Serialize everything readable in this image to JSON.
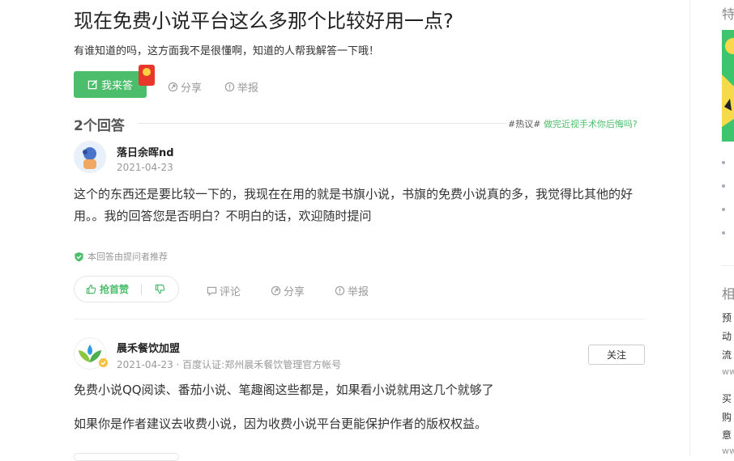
{
  "question": {
    "title": "现在免费小说平台这么多那个比较好用一点?",
    "description": "有谁知道的吗，这方面我不是很懂啊，知道的人帮我解答一下哦！"
  },
  "actions": {
    "answer_label": "我来答",
    "share_label": "分享",
    "report_label": "举报"
  },
  "answers_header": {
    "count_label": "2个回答",
    "hot_tag": "#热议#",
    "hot_link": "做完近视手术你后悔吗?"
  },
  "answers": [
    {
      "user": "落日余晖nd",
      "date": "2021-04-23",
      "paragraphs": [
        "这个的东西还是要比较一下的，我现在在用的就是书旗小说，书旗的免费小说真的多，我觉得比其他的好用。。我的回答您是否明白？不明白的话，欢迎随时提问"
      ],
      "recommend_label": "本回答由提问者推荐",
      "upvote_label": "抢首赞",
      "comment_label": "评论",
      "share_label": "分享",
      "report_label": "举报"
    },
    {
      "user": "晨禾餐饮加盟",
      "meta": "2021-04-23 · 百度认证:郑州晨禾餐饮管理官方帐号",
      "follow_label": "关注",
      "paragraphs": [
        "免费小说QQ阅读、番茄小说、笔趣阁这些都是，如果看小说就用这几个就够了",
        "如果你是作者建议去收费小说，因为收费小说平台更能保护作者的版权权益。"
      ]
    }
  ],
  "sidebar": {
    "title_top": "特",
    "title_related": "相",
    "items": [
      "预",
      "动",
      "流",
      "ww",
      "买",
      "购",
      "意",
      "ww"
    ]
  },
  "colors": {
    "accent": "#4cbd6a",
    "text": "#333333",
    "muted": "#999999"
  }
}
